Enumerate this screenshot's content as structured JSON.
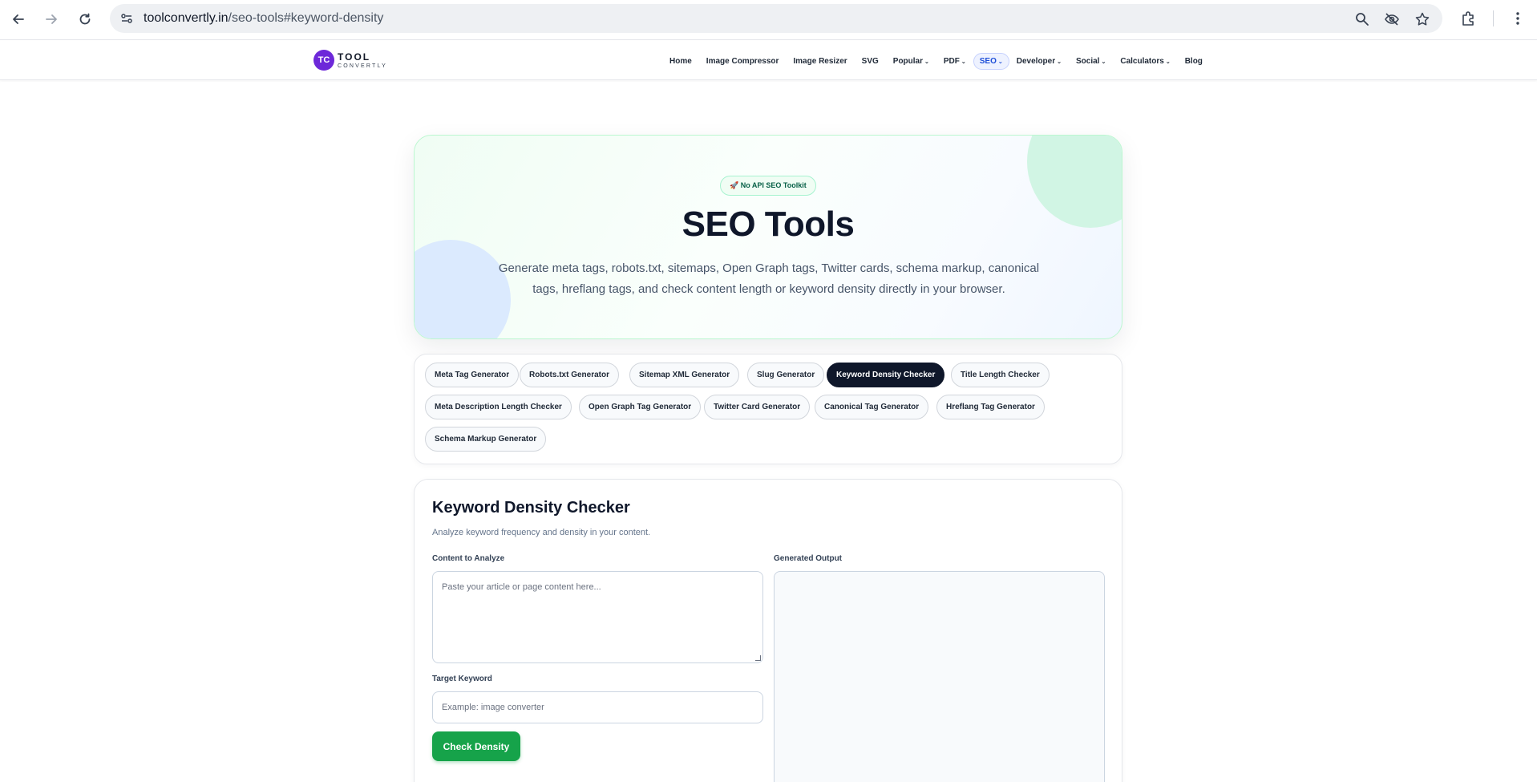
{
  "browser": {
    "url_domain": "toolconvertly.in",
    "url_path": "/seo-tools#keyword-density"
  },
  "header": {
    "logo_badge": "TC",
    "logo_line1": "TOOL",
    "logo_line2": "CONVERTLY",
    "nav": [
      {
        "label": "Home",
        "dropdown": false
      },
      {
        "label": "Image Compressor",
        "dropdown": false
      },
      {
        "label": "Image Resizer",
        "dropdown": false
      },
      {
        "label": "SVG",
        "dropdown": false
      },
      {
        "label": "Popular",
        "dropdown": true
      },
      {
        "label": "PDF",
        "dropdown": true
      },
      {
        "label": "SEO",
        "dropdown": true,
        "active": true
      },
      {
        "label": "Developer",
        "dropdown": true
      },
      {
        "label": "Social",
        "dropdown": true
      },
      {
        "label": "Calculators",
        "dropdown": true
      },
      {
        "label": "Blog",
        "dropdown": false
      }
    ],
    "caret": "⌄"
  },
  "hero": {
    "pill": "🚀 No API SEO Toolkit",
    "title": "SEO Tools",
    "description": "Generate meta tags, robots.txt, sitemaps, Open Graph tags, Twitter cards, schema markup, canonical tags, hreflang tags, and check content length or keyword density directly in your browser."
  },
  "tools": {
    "tabs": [
      "Meta Tag Generator",
      "Robots.txt Generator",
      "Sitemap XML Generator",
      "Slug Generator",
      "Keyword Density Checker",
      "Title Length Checker",
      "Meta Description Length Checker",
      "Open Graph Tag Generator",
      "Twitter Card Generator",
      "Canonical Tag Generator",
      "Hreflang Tag Generator",
      "Schema Markup Generator"
    ],
    "active_index": 4
  },
  "panel": {
    "title": "Keyword Density Checker",
    "subtitle": "Analyze keyword frequency and density in your content.",
    "content_label": "Content to Analyze",
    "content_placeholder": "Paste your article or page content here...",
    "output_label": "Generated Output",
    "keyword_label": "Target Keyword",
    "keyword_placeholder": "Example: image converter",
    "check_button": "Check Density"
  },
  "colors": {
    "accent_green": "#16a34a",
    "active_tab": "#0f172a",
    "logo_purple": "#6d28d9"
  }
}
